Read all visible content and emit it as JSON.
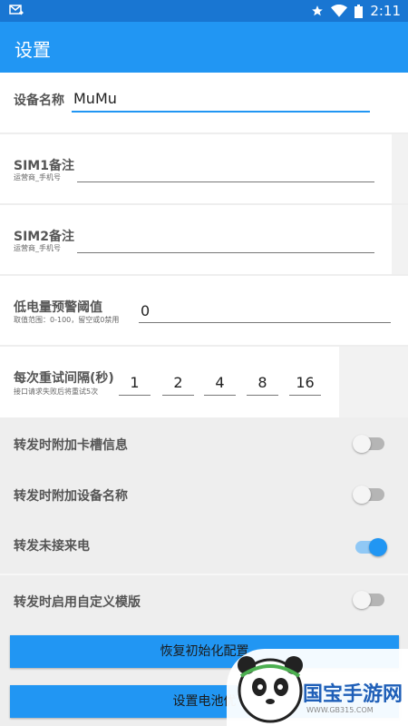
{
  "status_bar": {
    "time": "2:11",
    "icons": [
      "mail-notification-icon",
      "star-icon",
      "wifi-icon",
      "battery-icon"
    ]
  },
  "app_bar": {
    "title": "设置"
  },
  "device_name": {
    "label": "设备名称",
    "value": "MuMu"
  },
  "sim1": {
    "label": "SIM1备注",
    "hint": "运营商_手机号",
    "value": ""
  },
  "sim2": {
    "label": "SIM2备注",
    "hint": "运营商_手机号",
    "value": ""
  },
  "low_battery": {
    "label": "低电量预警阈值",
    "hint": "取值范围：0-100，留空或0禁用",
    "value": "0"
  },
  "retry": {
    "label": "每次重试间隔(秒)",
    "hint": "接口请求失败后将重试5次",
    "values": [
      "1",
      "2",
      "4",
      "8",
      "16"
    ]
  },
  "toggles": [
    {
      "label": "转发时附加卡槽信息",
      "on": false
    },
    {
      "label": "转发时附加设备名称",
      "on": false
    },
    {
      "label": "转发未接来电",
      "on": true
    },
    {
      "label": "转发时启用自定义模版",
      "on": false
    }
  ],
  "buttons": {
    "reset": "恢复初始化配置",
    "battery": "设置电池优"
  },
  "watermark": {
    "brand": "国宝手游网",
    "url": "WWW.GB315.COM"
  },
  "colors": {
    "primary": "#2196f3",
    "primary_dark": "#1976d2",
    "accent": "#2196f3"
  }
}
